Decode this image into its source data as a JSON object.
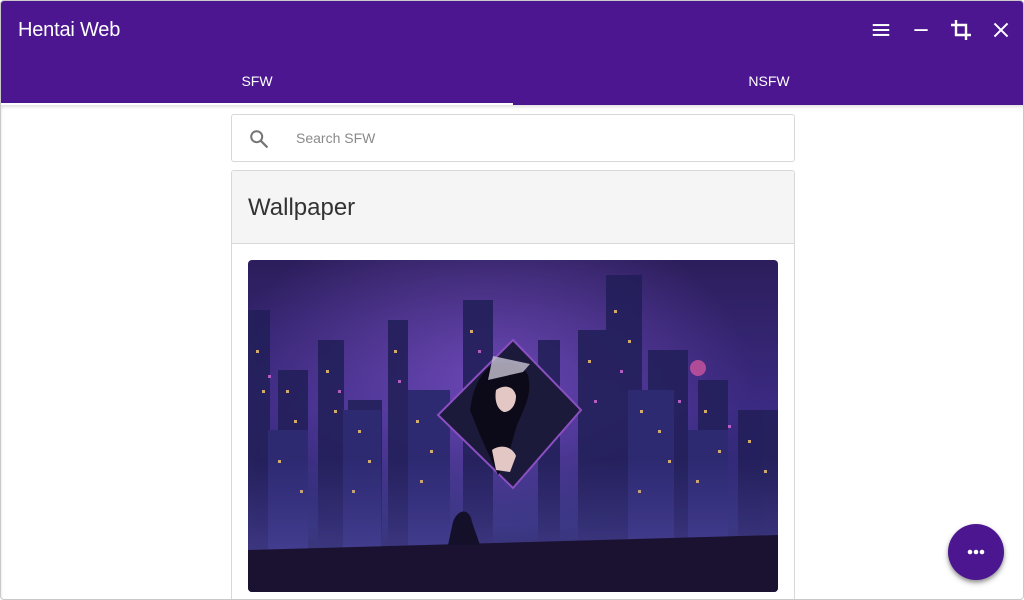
{
  "window": {
    "title": "Hentai Web",
    "controls": {
      "menu_icon": "menu-icon",
      "minimize_icon": "minimize-icon",
      "crop_icon": "crop-icon",
      "close_icon": "close-icon"
    }
  },
  "tabs": [
    {
      "label": "SFW",
      "active": true
    },
    {
      "label": "NSFW",
      "active": false
    }
  ],
  "search": {
    "placeholder": "Search SFW",
    "value": "",
    "icon": "search-icon"
  },
  "cards": [
    {
      "title": "Wallpaper",
      "image": "anime-city-night-wallpaper"
    }
  ],
  "fab": {
    "icon": "more-horizontal-icon"
  },
  "colors": {
    "primary": "#4b1690",
    "card_header": "#f5f5f5",
    "border": "#d8d8d8",
    "on_primary": "#ffffff"
  }
}
